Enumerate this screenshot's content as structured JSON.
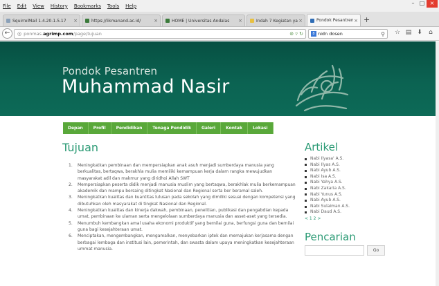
{
  "menu": [
    "File",
    "Edit",
    "View",
    "History",
    "Bookmarks",
    "Tools",
    "Help"
  ],
  "tabs": [
    {
      "label": "SquirrelMail 1.4.20-1.5.17",
      "active": false,
      "color": "#8aa0b8"
    },
    {
      "label": "https://likmanand.ac.id/",
      "active": false,
      "color": "#3a7a3a"
    },
    {
      "label": "HOME | Universitas Andalas",
      "active": false,
      "color": "#3a7a3a"
    },
    {
      "label": "Indah 7 Kegiatan yang Dap...",
      "active": false,
      "color": "#e8c040"
    },
    {
      "label": "Pondok Pesantren Muham...",
      "active": true,
      "color": "#2f6db5"
    }
  ],
  "new_tab_label": "+",
  "address": {
    "prefix": "ponmas.",
    "host": "agrimp.com",
    "path": "/page/tujuan"
  },
  "search": {
    "engine_label": "8",
    "query": "nidn dosen"
  },
  "site": {
    "subtitle": "Pondok Pesantren",
    "title": "Muhammad Nasir"
  },
  "nav": [
    "Depan",
    "Profil",
    "Pendidikan",
    "Tenaga Pendidik",
    "Galeri",
    "Kontak",
    "Lokasi"
  ],
  "tujuan": {
    "heading": "Tujuan",
    "items": [
      "Meningkatkan pembinaan dan mempersiapkan anak asuh menjadi sumberdaya manusia yang berkualitas, bertaqwa, berakhla mulia memiliki kemampuan kerja dalam rangka mewujudkan masyarakat adil dan makmur yang diridhoi Allah SWT",
      "Mempersiapkan peserta didik menjadi manusia muslim yang bertaqwa, berakhlak mulia berkemampuan akademik dan mampu bersaing ditingkat Nasional dan Regional serta ber beramal saleh.",
      "Meningkatkan kualitas dan kuantitas lulusan pada sekolah yang dimiliki sesuai dengan kompetensi yang dibutuhkan oleh masyarakat di tingkat Nasional dan Regional.",
      "Meningkatkan kualitas dan kinerja dakwah, pembinaan, penelitian, publikasi dan pengabdian kepada umat, pembinaan ke ulaman serta mengelolaan sumberdaya manusia dan asset-aset yang tersedia.",
      "Menumbuh kembangkan amal usaha ekonomi produktif yang bernilai guna, berfungsi guna dan bernilai guna bagi kesejahteraan umat.",
      "Menciptakan, mengembangkan, mengamalkan, menyebarkan iptek dan memajukan kerjasama dengan berbagai lembaga dan institusi lain, pemerintah, dan swasta dalam upaya meningkatkan kesejahteraan ummat manusia."
    ]
  },
  "artikel": {
    "heading": "Artikel",
    "items": [
      "Nabi Ilyasa' A.S.",
      "Nabi Ilyas A.S.",
      "Nabi Ayub A.S.",
      "Nabi Isa A.S.",
      "Nabi Yahya A.S.",
      "Nabi Zakaria A.S.",
      "Nabi Yunus A.S.",
      "Nabi Ayub A.S.",
      "Nabi Sulaiman A.S.",
      "Nabi Daud A.S."
    ],
    "pagination": "< 1 2 >"
  },
  "pencarian": {
    "heading": "Pencarian",
    "placeholder": "",
    "button": "Go"
  },
  "colors": {
    "header_green": "#0b6352",
    "nav_green": "#59a83a",
    "heading_teal": "#2a9a74"
  }
}
